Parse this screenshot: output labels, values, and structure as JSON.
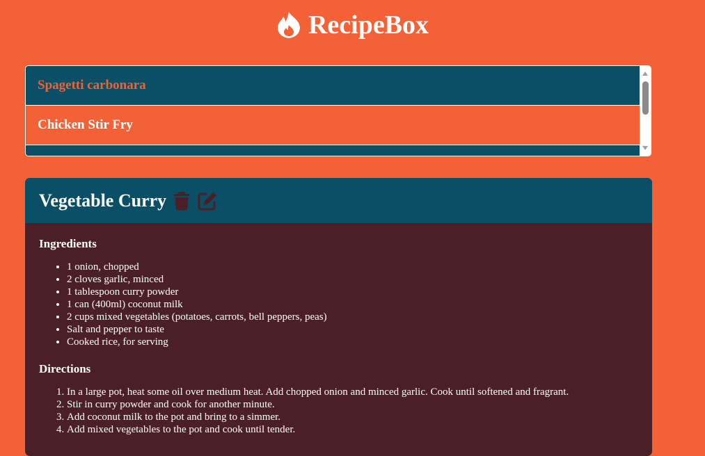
{
  "app": {
    "title": "RecipeBox",
    "logo_icon": "flame-icon",
    "background_color": "#f46136",
    "accent_color": "#0b4f66"
  },
  "recipe_list": {
    "items": [
      {
        "label": "Spagetti carbonara",
        "state": "active"
      },
      {
        "label": "Chicken Stir Fry",
        "state": "normal"
      }
    ]
  },
  "recipe": {
    "title": "Vegetable Curry",
    "delete_icon": "trash-icon",
    "edit_icon": "edit-icon",
    "ingredients_title": "Ingredients",
    "ingredients": [
      "1 onion, chopped",
      "2 cloves garlic, minced",
      "1 tablespoon curry powder",
      "1 can (400ml) coconut milk",
      "2 cups mixed vegetables (potatoes, carrots, bell peppers, peas)",
      "Salt and pepper to taste",
      "Cooked rice, for serving"
    ],
    "directions_title": "Directions",
    "directions": [
      "In a large pot, heat some oil over medium heat. Add chopped onion and minced garlic. Cook until softened and fragrant.",
      "Stir in curry powder and cook for another minute.",
      "Add coconut milk to the pot and bring to a simmer.",
      "Add mixed vegetables to the pot and cook until tender."
    ]
  }
}
